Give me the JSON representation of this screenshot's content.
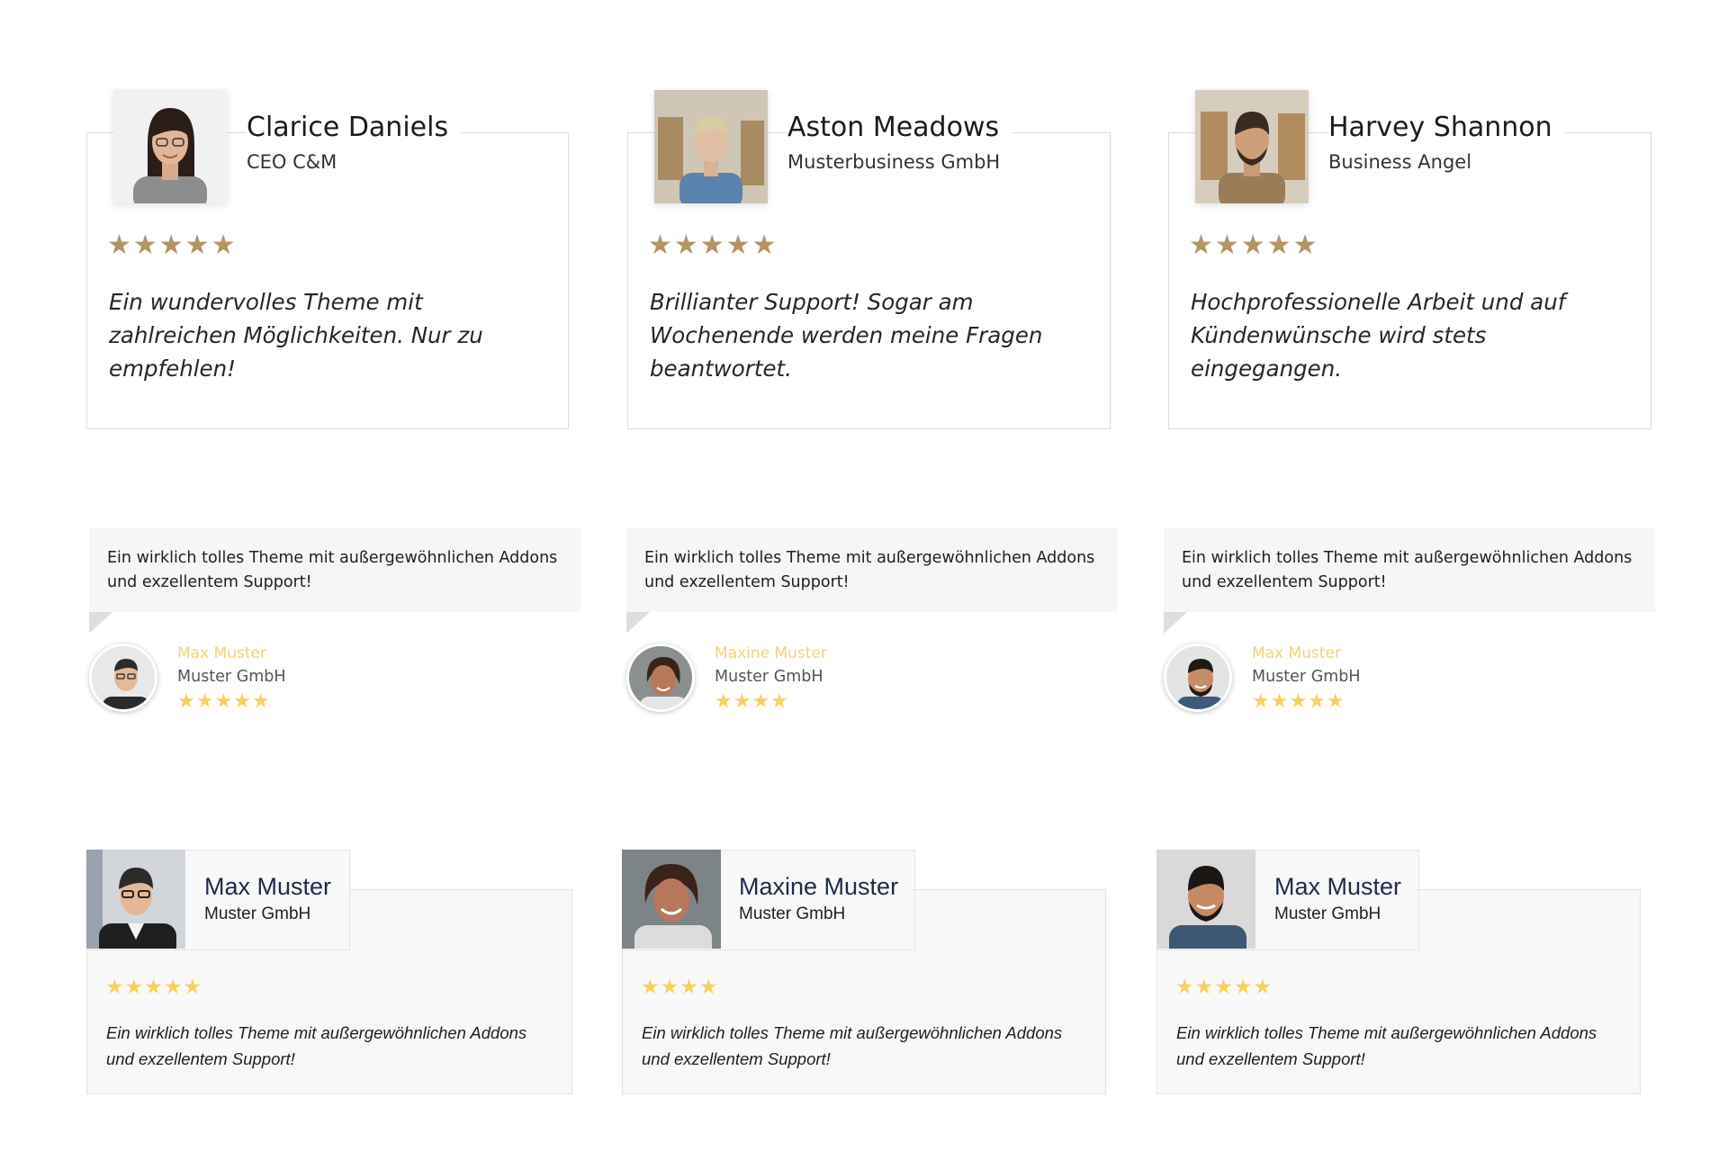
{
  "colors": {
    "row1_star": "#b39463",
    "row2_star": "#f6d25c",
    "row2_name": "#f2d27a",
    "row3_star": "#f6d25c",
    "row3_name": "#1e2c4a"
  },
  "row1": [
    {
      "name": "Clarice Daniels",
      "role": "CEO C&M",
      "stars": "★★★★★",
      "quote": "Ein wundervolles Theme mit zahlreichen Möglichkeiten. Nur zu empfehlen!"
    },
    {
      "name": "Aston Meadows",
      "role": "Musterbusiness GmbH",
      "stars": "★★★★★",
      "quote": "Brillianter Support! Sogar am Wochenende werden meine Fragen beantwortet."
    },
    {
      "name": "Harvey Shannon",
      "role": "Business Angel",
      "stars": "★★★★★",
      "quote": "Hochprofessionelle Arbeit und auf Kündenwünsche wird stets eingegangen."
    }
  ],
  "row2": [
    {
      "text": "Ein wirklich tolles Theme mit außergewöhnlichen Addons und exzellentem Support!",
      "name": "Max Muster",
      "company": "Muster GmbH",
      "stars": "★★★★★",
      "rating": 5
    },
    {
      "text": "Ein wirklich tolles Theme mit außergewöhnlichen Addons und exzellentem Support!",
      "name": "Maxine Muster",
      "company": "Muster GmbH",
      "stars": "★★★★",
      "rating": 4
    },
    {
      "text": "Ein wirklich tolles Theme mit außergewöhnlichen Addons und exzellentem Support!",
      "name": "Max Muster",
      "company": "Muster GmbH",
      "stars": "★★★★★",
      "rating": 5
    }
  ],
  "row3": [
    {
      "name": "Max Muster",
      "company": "Muster GmbH",
      "stars": "★★★★★",
      "rating": 5,
      "quote": "Ein wirklich tolles Theme mit außergewöhnlichen Addons und exzellentem Support!"
    },
    {
      "name": "Maxine Muster",
      "company": "Muster GmbH",
      "stars": "★★★★",
      "rating": 4,
      "quote": "Ein wirklich tolles Theme mit außergewöhnlichen Addons und exzellentem Support!"
    },
    {
      "name": "Max Muster",
      "company": "Muster GmbH",
      "stars": "★★★★★",
      "rating": 5,
      "quote": "Ein wirklich tolles Theme mit außergewöhnlichen Addons und exzellentem Support!"
    }
  ]
}
